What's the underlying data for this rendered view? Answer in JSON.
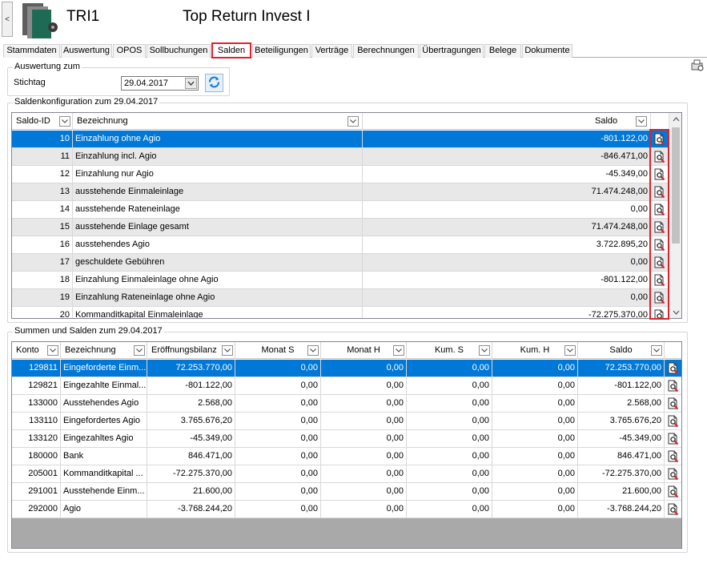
{
  "header": {
    "collapse_glyph": "<",
    "short_name": "TRI1",
    "long_name": "Top Return Invest I"
  },
  "tabs": [
    {
      "label": "Stammdaten",
      "active": false
    },
    {
      "label": "Auswertung",
      "active": false
    },
    {
      "label": "OPOS",
      "active": false
    },
    {
      "label": "Sollbuchungen",
      "active": false
    },
    {
      "label": "Salden",
      "active": true
    },
    {
      "label": "Beteiligungen",
      "active": false
    },
    {
      "label": "Verträge",
      "active": false
    },
    {
      "label": "Berechnungen",
      "active": false
    },
    {
      "label": "Übertragungen",
      "active": false
    },
    {
      "label": "Belege",
      "active": false
    },
    {
      "label": "Dokumente",
      "active": false
    }
  ],
  "auswertung": {
    "group_title": "Auswertung zum",
    "stichtag_label": "Stichtag",
    "stichtag_value": "29.04.2017"
  },
  "config": {
    "group_title": "Saldenkonfiguration zum 29.04.2017",
    "columns": [
      "Saldo-ID",
      "Bezeichnung",
      "Saldo"
    ],
    "rows": [
      {
        "id": "10",
        "name": "Einzahlung ohne Agio",
        "saldo": "-801.122,00"
      },
      {
        "id": "11",
        "name": "Einzahlung incl. Agio",
        "saldo": "-846.471,00"
      },
      {
        "id": "12",
        "name": "Einzahlung nur Agio",
        "saldo": "-45.349,00"
      },
      {
        "id": "13",
        "name": "ausstehende Einmaleinlage",
        "saldo": "71.474.248,00"
      },
      {
        "id": "14",
        "name": "ausstehende Rateneinlage",
        "saldo": "0,00"
      },
      {
        "id": "15",
        "name": "ausstehende Einlage gesamt",
        "saldo": "71.474.248,00"
      },
      {
        "id": "16",
        "name": "ausstehendes Agio",
        "saldo": "3.722.895,20"
      },
      {
        "id": "17",
        "name": "geschuldete Gebühren",
        "saldo": "0,00"
      },
      {
        "id": "18",
        "name": "Einzahlung Einmaleinlage ohne Agio",
        "saldo": "-801.122,00"
      },
      {
        "id": "19",
        "name": "Einzahlung Rateneinlage ohne Agio",
        "saldo": "0,00"
      },
      {
        "id": "20",
        "name": "Kommanditkapital Einmaleinlage",
        "saldo": "-72.275.370,00"
      }
    ]
  },
  "summen": {
    "group_title": "Summen und Salden zum 29.04.2017",
    "columns": [
      "Konto",
      "Bezeichnung",
      "Eröffnungsbilanz",
      "Monat S",
      "Monat H",
      "Kum. S",
      "Kum. H",
      "Saldo"
    ],
    "rows": [
      {
        "konto": "129811",
        "name": "Eingeforderte Einm...",
        "eb": "72.253.770,00",
        "ms": "0,00",
        "mh": "0,00",
        "ks": "0,00",
        "kh": "0,00",
        "saldo": "72.253.770,00"
      },
      {
        "konto": "129821",
        "name": "Eingezahlte Einmal...",
        "eb": "-801.122,00",
        "ms": "0,00",
        "mh": "0,00",
        "ks": "0,00",
        "kh": "0,00",
        "saldo": "-801.122,00"
      },
      {
        "konto": "133000",
        "name": "Ausstehendes Agio",
        "eb": "2.568,00",
        "ms": "0,00",
        "mh": "0,00",
        "ks": "0,00",
        "kh": "0,00",
        "saldo": "2.568,00"
      },
      {
        "konto": "133110",
        "name": "Eingefordertes Agio",
        "eb": "3.765.676,20",
        "ms": "0,00",
        "mh": "0,00",
        "ks": "0,00",
        "kh": "0,00",
        "saldo": "3.765.676,20"
      },
      {
        "konto": "133120",
        "name": "Eingezahltes Agio",
        "eb": "-45.349,00",
        "ms": "0,00",
        "mh": "0,00",
        "ks": "0,00",
        "kh": "0,00",
        "saldo": "-45.349,00"
      },
      {
        "konto": "180000",
        "name": "Bank",
        "eb": "846.471,00",
        "ms": "0,00",
        "mh": "0,00",
        "ks": "0,00",
        "kh": "0,00",
        "saldo": "846.471,00"
      },
      {
        "konto": "205001",
        "name": "Kommanditkapital ...",
        "eb": "-72.275.370,00",
        "ms": "0,00",
        "mh": "0,00",
        "ks": "0,00",
        "kh": "0,00",
        "saldo": "-72.275.370,00"
      },
      {
        "konto": "291001",
        "name": "Ausstehende Einm...",
        "eb": "21.600,00",
        "ms": "0,00",
        "mh": "0,00",
        "ks": "0,00",
        "kh": "0,00",
        "saldo": "21.600,00"
      },
      {
        "konto": "292000",
        "name": "Agio",
        "eb": "-3.768.244,20",
        "ms": "0,00",
        "mh": "0,00",
        "ks": "0,00",
        "kh": "0,00",
        "saldo": "-3.768.244,20"
      }
    ]
  },
  "icons": {
    "row_action": "document-search-icon",
    "refresh": "refresh-icon",
    "filter": "filter-dropdown-icon"
  },
  "colors": {
    "selection": "#0078d7",
    "highlight_border": "#d9232e",
    "alt_row": "#e8e8e8"
  }
}
